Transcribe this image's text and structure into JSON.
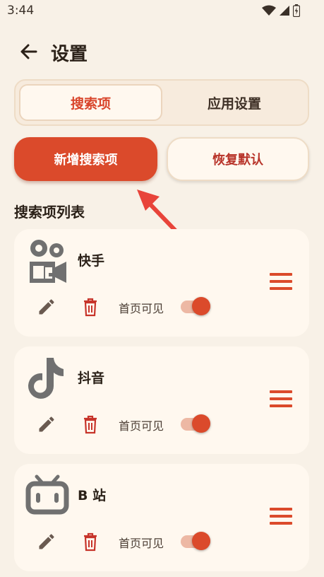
{
  "status_bar": {
    "time": "3:44"
  },
  "app_bar": {
    "title": "设置"
  },
  "tabs": [
    {
      "label": "搜索项",
      "active": true
    },
    {
      "label": "应用设置",
      "active": false
    }
  ],
  "actions": {
    "add_label": "新增搜索项",
    "reset_label": "恢复默认"
  },
  "section_title": "搜索项列表",
  "items": [
    {
      "name": "快手",
      "logo": "kuaishou-logo",
      "visible_label": "首页可见",
      "visible": true
    },
    {
      "name": "抖音",
      "logo": "douyin-logo",
      "visible_label": "首页可见",
      "visible": true
    },
    {
      "name": "B 站",
      "logo": "bilibili-logo",
      "visible_label": "首页可见",
      "visible": true
    }
  ],
  "colors": {
    "accent": "#DB4A2B",
    "background": "#F8F1E7",
    "card": "#FFF8EF",
    "toggle_track": "#EDB8A4"
  }
}
